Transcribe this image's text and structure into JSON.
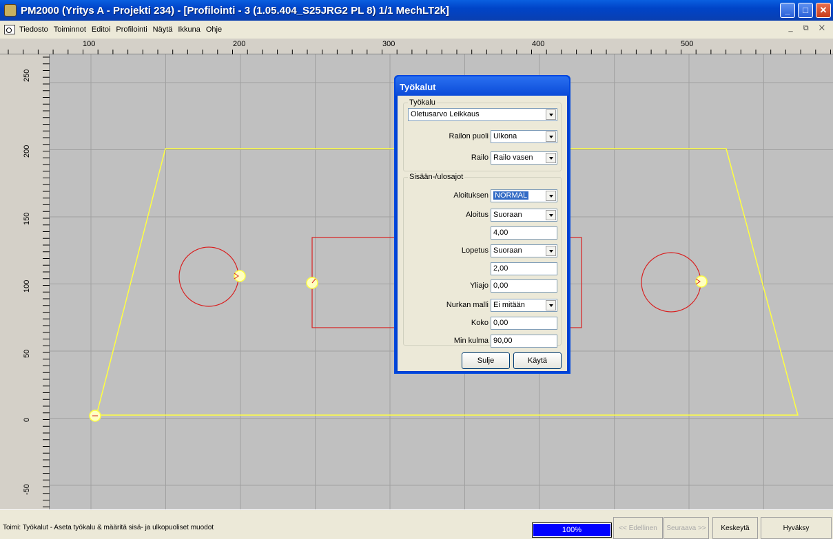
{
  "window": {
    "title": "PM2000 (Yritys A - Projekti 234) - [Profilointi - 3 (1.05.404_S25JRG2 PL 8) 1/1  MechLT2k]",
    "minimize_glyph": "_",
    "maximize_glyph": "□",
    "close_glyph": "✕",
    "mdi_glyphs": "_ ⧉ ✕"
  },
  "menu": {
    "items": [
      "Tiedosto",
      "Toiminnot",
      "Editoi",
      "Profilointi",
      "Näytä",
      "Ikkuna",
      "Ohje"
    ]
  },
  "ruler_top": {
    "labels": [
      "100",
      "200",
      "300",
      "400",
      "500"
    ]
  },
  "ruler_left": {
    "labels": [
      "250",
      "200",
      "150",
      "100",
      "50",
      "0",
      "-50"
    ]
  },
  "colors": {
    "outline": "#ffff40",
    "contour": "#d82020",
    "grid": "#a0a0a0"
  },
  "dialog": {
    "title": "Työkalut",
    "tool_group": {
      "legend": "Työkalu",
      "tool_value": "Oletusarvo Leikkaus",
      "kerf_side_label": "Railon puoli",
      "kerf_side_value": "Ulkona",
      "kerf_label": "Railo",
      "kerf_value": "Railo vasen"
    },
    "lead_group": {
      "legend": "Sisään-/ulosajot",
      "start_type_label": "Aloituksen",
      "start_type_value": "NORMAL",
      "lead_in_label": "Aloitus",
      "lead_in_value": "Suoraan",
      "lead_in_length": "4,00",
      "lead_out_label": "Lopetus",
      "lead_out_value": "Suoraan",
      "lead_out_length": "2,00",
      "overrun_label": "Yliajo",
      "overrun_value": "0,00",
      "corner_label": "Nurkan malli",
      "corner_value": "Ei mitään",
      "size_label": "Koko",
      "size_value": "0,00",
      "min_angle_label": "Min kulma",
      "min_angle_value": "90,00"
    },
    "close_button": "Sulje",
    "apply_button": "Käytä"
  },
  "status": {
    "text": "Toimi: Työkalut - Aseta työkalu & määritä sisä- ja ulkopuoliset muodot",
    "progress_label": "100%",
    "progress": 1.0,
    "prev_button": "<< Edellinen",
    "next_button": "Seuraava >>",
    "cancel_button": "Keskeytä",
    "accept_button": "Hyväksy"
  }
}
